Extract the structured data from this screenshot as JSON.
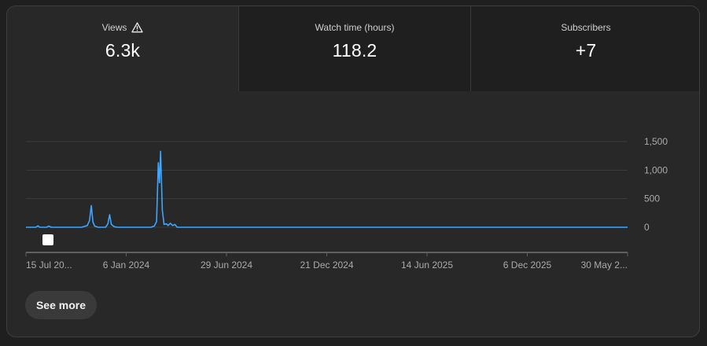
{
  "metrics": [
    {
      "label": "Views",
      "value": "6.3k",
      "icon": "warning-icon"
    },
    {
      "label": "Watch time (hours)",
      "value": "118.2"
    },
    {
      "label": "Subscribers",
      "value": "+7"
    }
  ],
  "chart_data": {
    "type": "line",
    "series": [
      {
        "values": [
          [
            "2023-07-15",
            0
          ],
          [
            "2023-08-01",
            0
          ],
          [
            "2023-08-05",
            25
          ],
          [
            "2023-08-08",
            0
          ],
          [
            "2023-08-20",
            0
          ],
          [
            "2023-08-24",
            20
          ],
          [
            "2023-08-28",
            0
          ],
          [
            "2023-10-20",
            0
          ],
          [
            "2023-10-30",
            30
          ],
          [
            "2023-11-03",
            120
          ],
          [
            "2023-11-06",
            380
          ],
          [
            "2023-11-09",
            90
          ],
          [
            "2023-11-12",
            20
          ],
          [
            "2023-11-18",
            0
          ],
          [
            "2023-12-01",
            0
          ],
          [
            "2023-12-05",
            60
          ],
          [
            "2023-12-08",
            220
          ],
          [
            "2023-12-11",
            50
          ],
          [
            "2023-12-16",
            10
          ],
          [
            "2023-12-22",
            0
          ],
          [
            "2024-02-18",
            0
          ],
          [
            "2024-02-24",
            20
          ],
          [
            "2024-02-28",
            100
          ],
          [
            "2024-03-02",
            1130
          ],
          [
            "2024-03-04",
            780
          ],
          [
            "2024-03-06",
            1330
          ],
          [
            "2024-03-09",
            300
          ],
          [
            "2024-03-12",
            50
          ],
          [
            "2024-03-16",
            60
          ],
          [
            "2024-03-19",
            30
          ],
          [
            "2024-03-23",
            70
          ],
          [
            "2024-03-27",
            30
          ],
          [
            "2024-03-31",
            50
          ],
          [
            "2024-04-04",
            0
          ],
          [
            "2024-06-29",
            0
          ],
          [
            "2024-12-21",
            0
          ],
          [
            "2025-06-14",
            0
          ],
          [
            "2025-12-06",
            0
          ],
          [
            "2026-05-30",
            0
          ]
        ]
      }
    ],
    "x_ticks": [
      "15 Jul 20...",
      "6 Jan 2024",
      "29 Jun 2024",
      "21 Dec 2024",
      "14 Jun 2025",
      "6 Dec 2025",
      "30 May 2..."
    ],
    "x_tick_dates": [
      "2023-07-15",
      "2024-01-06",
      "2024-06-29",
      "2024-12-21",
      "2025-06-14",
      "2025-12-06",
      "2026-05-30"
    ],
    "y_ticks": [
      "0",
      "500",
      "1,000",
      "1,500"
    ],
    "y_tick_values": [
      0,
      500,
      1000,
      1500
    ],
    "xlim": [
      "2023-07-15",
      "2026-05-30"
    ],
    "ylim": [
      0,
      1500
    ],
    "grid": true,
    "line_color": "#3ea6ff",
    "marker_color": "#ffffff"
  },
  "actions": {
    "see_more": "See more"
  },
  "colors": {
    "background": "#282828",
    "tab_inactive": "#1f1f1f",
    "line": "#3ea6ff"
  }
}
